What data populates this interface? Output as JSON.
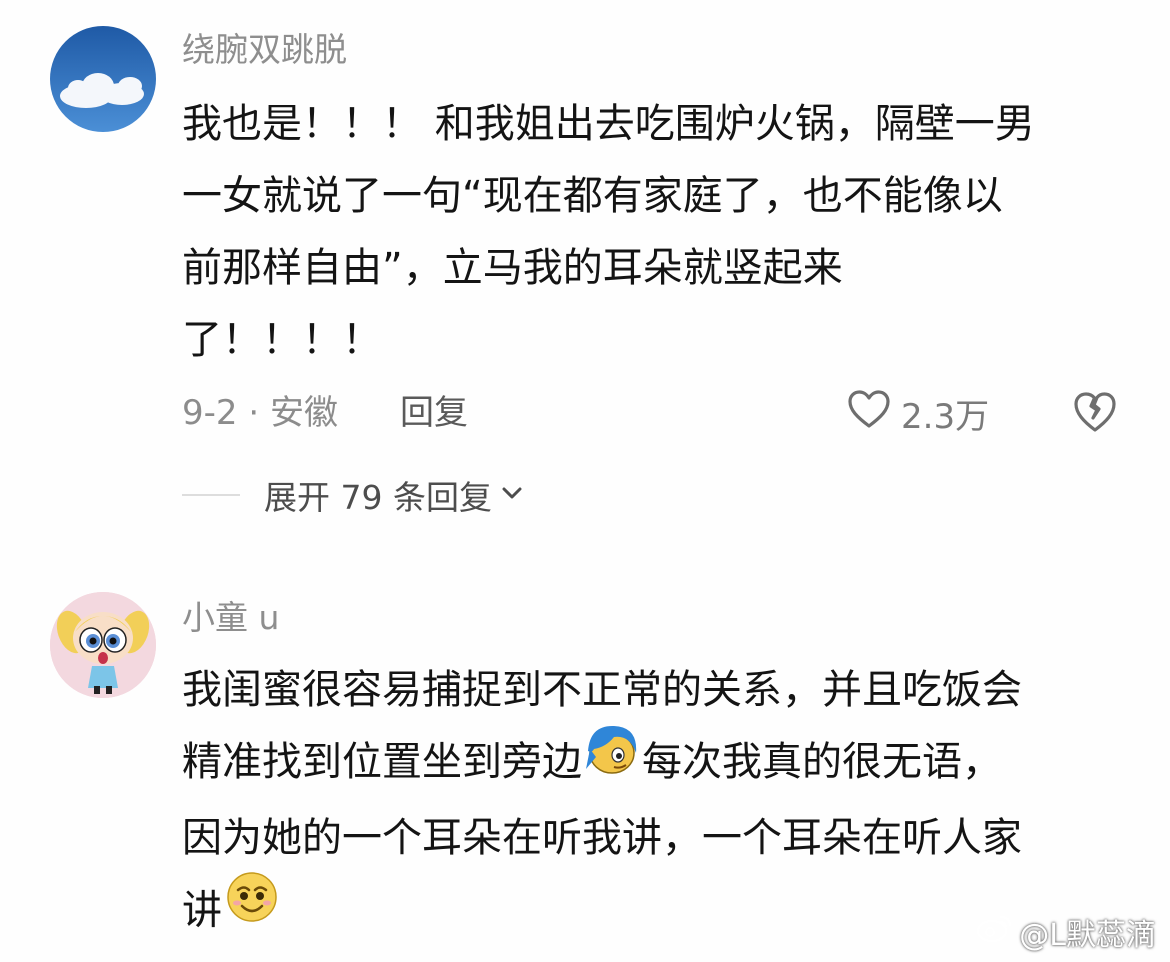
{
  "comments": [
    {
      "username": "绕腕双跳脱",
      "lines": [
        "我也是！！！ 和我姐出去吃围炉火锅，隔壁一男",
        "一女就说了一句“现在都有家庭了，也不能像以",
        "前那样自由”，立马我的耳朵就竖起来",
        "了！！！！"
      ],
      "date_location": "9-2 · 安徽",
      "reply_label": "回复",
      "like_count": "2.3万",
      "expand_label": "展开 79 条回复"
    },
    {
      "username": "小童 u",
      "lines": [
        "我闺蜜很容易捕捉到不正常的关系，并且吃饭会",
        "精准找到位置坐到旁边",
        "每次我真的很无语，",
        "因为她的一个耳朵在听我讲，一个耳朵在听人家",
        "讲"
      ]
    }
  ],
  "icons": {
    "like": "heart-icon",
    "dislike": "broken-heart-icon",
    "expand": "chevron-down-icon",
    "emoji1": "blue-hair-face-emoji",
    "emoji2": "smiling-face-emoji"
  },
  "watermark": "@L默蕊滴"
}
